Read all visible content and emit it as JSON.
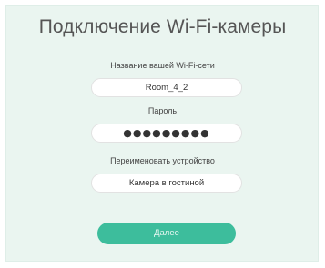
{
  "title": "Подключение Wi-Fi-камеры",
  "form": {
    "wifi_label": "Название вашей Wi-Fi-сети",
    "wifi_value": "Room_4_2",
    "password_label": "Пароль",
    "password_value": "●●●●●●●●●",
    "rename_label": "Переименовать устройство",
    "rename_value": "Камера в гостиной"
  },
  "next_button": "Далее",
  "colors": {
    "panel_bg": "#eaf5f0",
    "accent": "#3dbd9c"
  }
}
